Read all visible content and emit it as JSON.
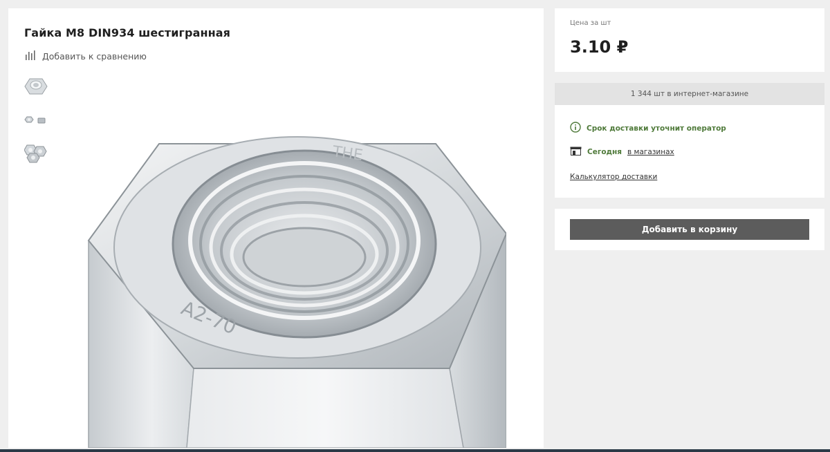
{
  "product": {
    "title": "Гайка М8 DIN934 шестигранная",
    "compare_label": "Добавить к сравнению"
  },
  "gallery": {
    "thumbnails": [
      "nut-thumb-1",
      "nut-thumb-2",
      "nut-thumb-3"
    ],
    "main_image": "hex-nut-photo"
  },
  "price": {
    "label": "Цена за шт",
    "value": "3.10 ₽"
  },
  "availability": {
    "stock_text": "1 344 шт в интернет-магазине",
    "delivery_text": "Срок доставки уточнит оператор",
    "stores_prefix": "Сегодня",
    "stores_link": "в магазинах",
    "calculator_link": "Калькулятор доставки"
  },
  "cart": {
    "button_label": "Добавить в корзину"
  },
  "colors": {
    "accent_green": "#4f7a3a",
    "button_bg": "#5c5c5c",
    "page_bg": "#efefef"
  }
}
